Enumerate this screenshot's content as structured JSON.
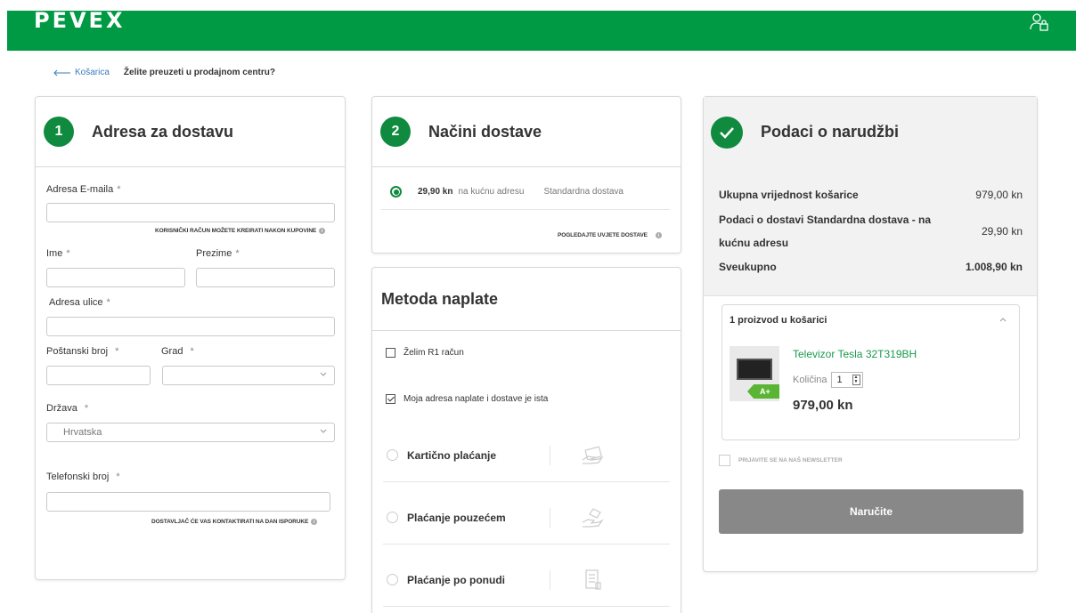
{
  "header": {
    "logo": "PEVEX",
    "user_icon": "user-icon",
    "brand_color": "#009a45"
  },
  "breadcrumb": {
    "back_label": "Košarica",
    "pickup_link": "Želite preuzeti u prodajnom centru?"
  },
  "address": {
    "step": "1",
    "title": "Adresa za dostavu",
    "email_label": "Adresa E-maila",
    "email_hint": "KORISNIČKI RAČUN MOŽETE KREIRATI NAKON KUPOVINE",
    "first_name_label": "Ime",
    "last_name_label": "Prezime",
    "street_label": "Adresa ulice",
    "postal_label": "Poštanski broj",
    "city_label": "Grad",
    "country_label": "Država",
    "country_value": "Hrvatska",
    "phone_label": "Telefonski broj",
    "phone_hint": "DOSTAVLJAČ ĆE VAS KONTAKTIRATI NA DAN ISPORUKE",
    "required_mark": "*"
  },
  "shipping": {
    "step": "2",
    "title": "Načini dostave",
    "price": "29,90 kn",
    "where": "na kućnu adresu",
    "type": "Standardna dostava",
    "terms_link": "POGLEDAJTE UVJETE DOSTAVE"
  },
  "payment": {
    "title": "Metoda naplate",
    "r1_label": "Želim R1 račun",
    "r1_checked": false,
    "same_address_label": "Moja adresa naplate i dostave je ista",
    "same_address_checked": true,
    "methods": [
      {
        "label": "Kartično plaćanje",
        "icon": "card-payment-icon"
      },
      {
        "label": "Plaćanje pouzećem",
        "icon": "cash-hand-icon"
      },
      {
        "label": "Plaćanje po ponudi",
        "icon": "document-icon"
      }
    ]
  },
  "order": {
    "title": "Podaci o narudžbi",
    "cart_total_label": "Ukupna vrijednost košarice",
    "cart_total_value": "979,00 kn",
    "shipping_label": "Podaci o dostavi Standardna dostava - na kućnu adresu",
    "shipping_value": "29,90 kn",
    "grand_total_label": "Sveukupno",
    "grand_total_value": "1.008,90 kn",
    "cart_header": "1 proizvod u košarici",
    "product_name": "Televizor Tesla 32T319BH",
    "energy_class": "A+",
    "qty_label": "Količina",
    "qty_value": "1",
    "product_price": "979,00 kn",
    "newsletter_label": "PRIJAVITE SE NA NAŠ NEWSLETTER",
    "submit_label": "Naručite"
  }
}
